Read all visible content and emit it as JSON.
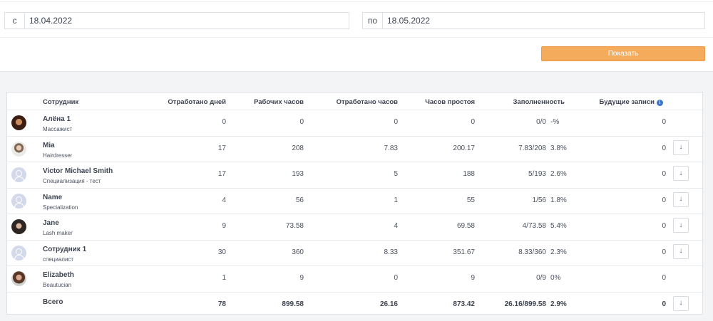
{
  "filters": {
    "from_label": "с",
    "from_value": "18.04.2022",
    "to_label": "по",
    "to_value": "18.05.2022",
    "show_button": "Показать",
    "accent_color": "#f4ab5c"
  },
  "table": {
    "columns": {
      "employee": "Сотрудник",
      "days_worked": "Отработано дней",
      "work_hours": "Рабочих часов",
      "hours_worked": "Отработано часов",
      "idle_hours": "Часов простоя",
      "occupancy": "Заполненность",
      "future_bookings": "Будущие записи"
    },
    "rows": [
      {
        "name": "Алёна 1",
        "specialization": "Массажист",
        "avatar": "photo",
        "days": "0",
        "work_hours": "0",
        "worked": "0",
        "idle": "0",
        "fill": "0/0",
        "pct": "-%",
        "future": "0",
        "download": false
      },
      {
        "name": "Mia",
        "specialization": "Hairdresser",
        "avatar": "photo",
        "days": "17",
        "work_hours": "208",
        "worked": "7.83",
        "idle": "200.17",
        "fill": "7.83/208",
        "pct": "3.8%",
        "future": "0",
        "download": true
      },
      {
        "name": "Victor Michael Smith",
        "specialization": "Специализация - тест",
        "avatar": "placeholder",
        "days": "17",
        "work_hours": "193",
        "worked": "5",
        "idle": "188",
        "fill": "5/193",
        "pct": "2.6%",
        "future": "0",
        "download": true
      },
      {
        "name": "Name",
        "specialization": "Specialization",
        "avatar": "placeholder",
        "days": "4",
        "work_hours": "56",
        "worked": "1",
        "idle": "55",
        "fill": "1/56",
        "pct": "1.8%",
        "future": "0",
        "download": true
      },
      {
        "name": "Jane",
        "specialization": "Lash maker",
        "avatar": "photo",
        "days": "9",
        "work_hours": "73.58",
        "worked": "4",
        "idle": "69.58",
        "fill": "4/73.58",
        "pct": "5.4%",
        "future": "0",
        "download": true
      },
      {
        "name": "Сотрудник 1",
        "specialization": "специалист",
        "avatar": "placeholder",
        "days": "30",
        "work_hours": "360",
        "worked": "8.33",
        "idle": "351.67",
        "fill": "8.33/360",
        "pct": "2.3%",
        "future": "0",
        "download": true
      },
      {
        "name": "Elizabeth",
        "specialization": "Beautucian",
        "avatar": "photo",
        "days": "1",
        "work_hours": "9",
        "worked": "0",
        "idle": "9",
        "fill": "0/9",
        "pct": "0%",
        "future": "0",
        "download": false
      }
    ],
    "total": {
      "label": "Всего",
      "days": "78",
      "work_hours": "899.58",
      "worked": "26.16",
      "idle": "873.42",
      "fill": "26.16/899.58",
      "pct": "2.9%",
      "future": "0"
    }
  }
}
